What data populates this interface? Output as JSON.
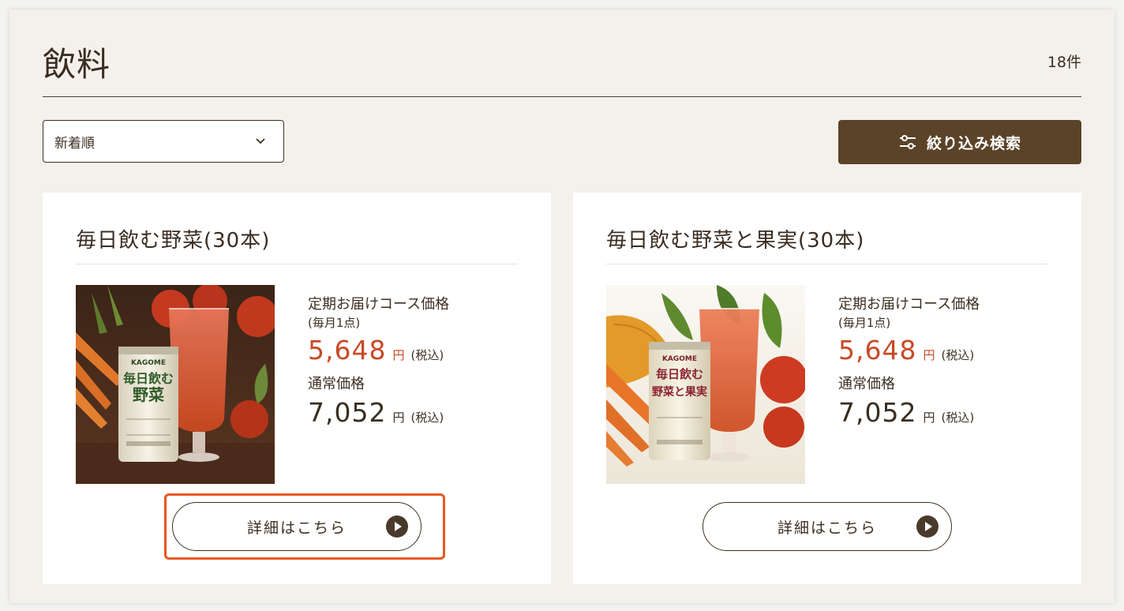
{
  "page": {
    "title": "飲料",
    "count": "18件"
  },
  "toolbar": {
    "sort_value": "新着順",
    "filter_label": "絞り込み検索"
  },
  "products": [
    {
      "name": "毎日飲む野菜(30本)",
      "plan_label": "定期お届けコース価格",
      "plan_sub": "(毎月1点)",
      "plan_price": "5,648",
      "normal_label": "通常価格",
      "normal_price": "7,052",
      "yen": "円",
      "tax": "(税込)",
      "detail_label": "詳細はこちら",
      "can_brand": "KAGOME",
      "can_title_line1": "毎日飲む",
      "can_title_line2": "野菜"
    },
    {
      "name": "毎日飲む野菜と果実(30本)",
      "plan_label": "定期お届けコース価格",
      "plan_sub": "(毎月1点)",
      "plan_price": "5,648",
      "normal_label": "通常価格",
      "normal_price": "7,052",
      "yen": "円",
      "tax": "(税込)",
      "detail_label": "詳細はこちら",
      "can_brand": "KAGOME",
      "can_title_line1": "毎日飲む",
      "can_title_line2": "野菜と果実"
    }
  ],
  "colors": {
    "accent_red": "#c84a27",
    "button_brown": "#5b4328",
    "highlight": "#e8571f"
  }
}
